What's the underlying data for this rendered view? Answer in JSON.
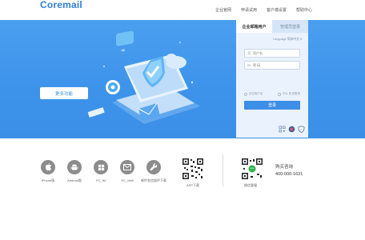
{
  "header": {
    "logo": "Coremail",
    "nav": [
      "企业官网",
      "申请试用",
      "客户端设置",
      "帮助中心"
    ]
  },
  "hero": {
    "button_label": "更多功能"
  },
  "login": {
    "tabs": [
      "企业邮箱用户",
      "管理员登录"
    ],
    "language": "Language 简体中文 ▾",
    "username_placeholder": "用户名",
    "password_placeholder": "密 码",
    "remember_label": "记住用户名",
    "ssl_label": "SSL 安全登录",
    "submit_label": "登录"
  },
  "apps": [
    {
      "label": "iPhone版",
      "icon": "apple-icon"
    },
    {
      "label": "Android版",
      "icon": "android-icon"
    },
    {
      "label": "PC_IM",
      "icon": "windows-icon"
    },
    {
      "label": "PC_Mail",
      "icon": "mail-icon"
    },
    {
      "label": "邮件发信插件下载",
      "icon": "wrench-icon"
    }
  ],
  "qr": {
    "app_label": "APP下载",
    "wechat_label": "微信客服"
  },
  "contact": {
    "title": "购买咨询",
    "phone": "400-000-1631"
  },
  "colors": {
    "brand": "#2f7fd6",
    "hero_bg": "#3d93ea",
    "login_bg": "#eaf2fd",
    "submit": "#3c8ee6",
    "app_icon_bg": "#8c8c8c"
  }
}
